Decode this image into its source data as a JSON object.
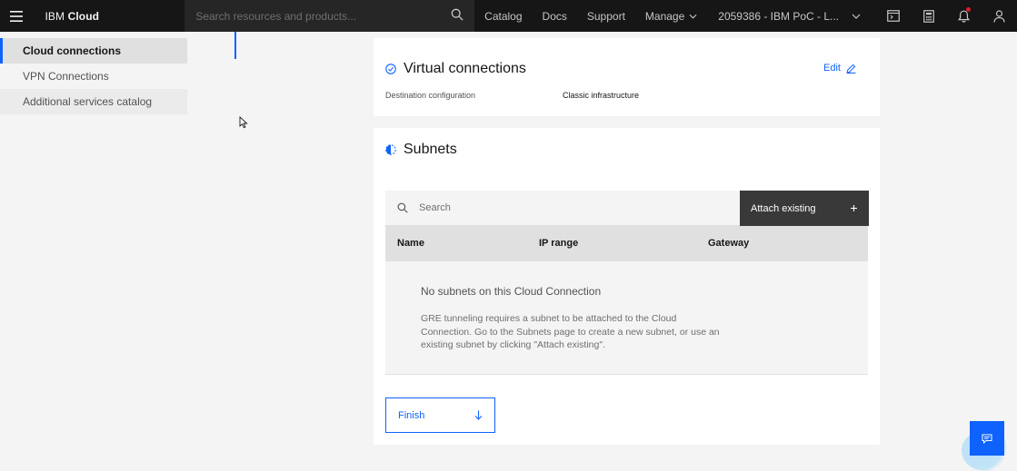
{
  "header": {
    "brand_prefix": "IBM",
    "brand_name": "Cloud",
    "search_placeholder": "Search resources and products...",
    "nav": [
      "Catalog",
      "Docs",
      "Support"
    ],
    "manage_label": "Manage",
    "account_label": "2059386 - IBM PoC - L..."
  },
  "sidebar": {
    "items": [
      {
        "label": "Cloud connections"
      },
      {
        "label": "VPN Connections"
      },
      {
        "label": "Additional services catalog"
      }
    ]
  },
  "virtual_connections": {
    "title": "Virtual connections",
    "edit_label": "Edit",
    "field_label": "Destination configuration",
    "field_value": "Classic infrastructure"
  },
  "subnets": {
    "title": "Subnets",
    "search_placeholder": "Search",
    "attach_label": "Attach existing",
    "columns": [
      "Name",
      "IP range",
      "Gateway"
    ],
    "empty_title": "No subnets on this Cloud Connection",
    "empty_body": "GRE tunneling requires a subnet to be attached to the Cloud Connection. Go to the Subnets page to create a new subnet, or use an existing subnet by clicking \"Attach existing\"."
  },
  "finish_label": "Finish",
  "colors": {
    "accent": "#0f62fe",
    "header_bg": "#161616",
    "notification": "#da1e28"
  }
}
